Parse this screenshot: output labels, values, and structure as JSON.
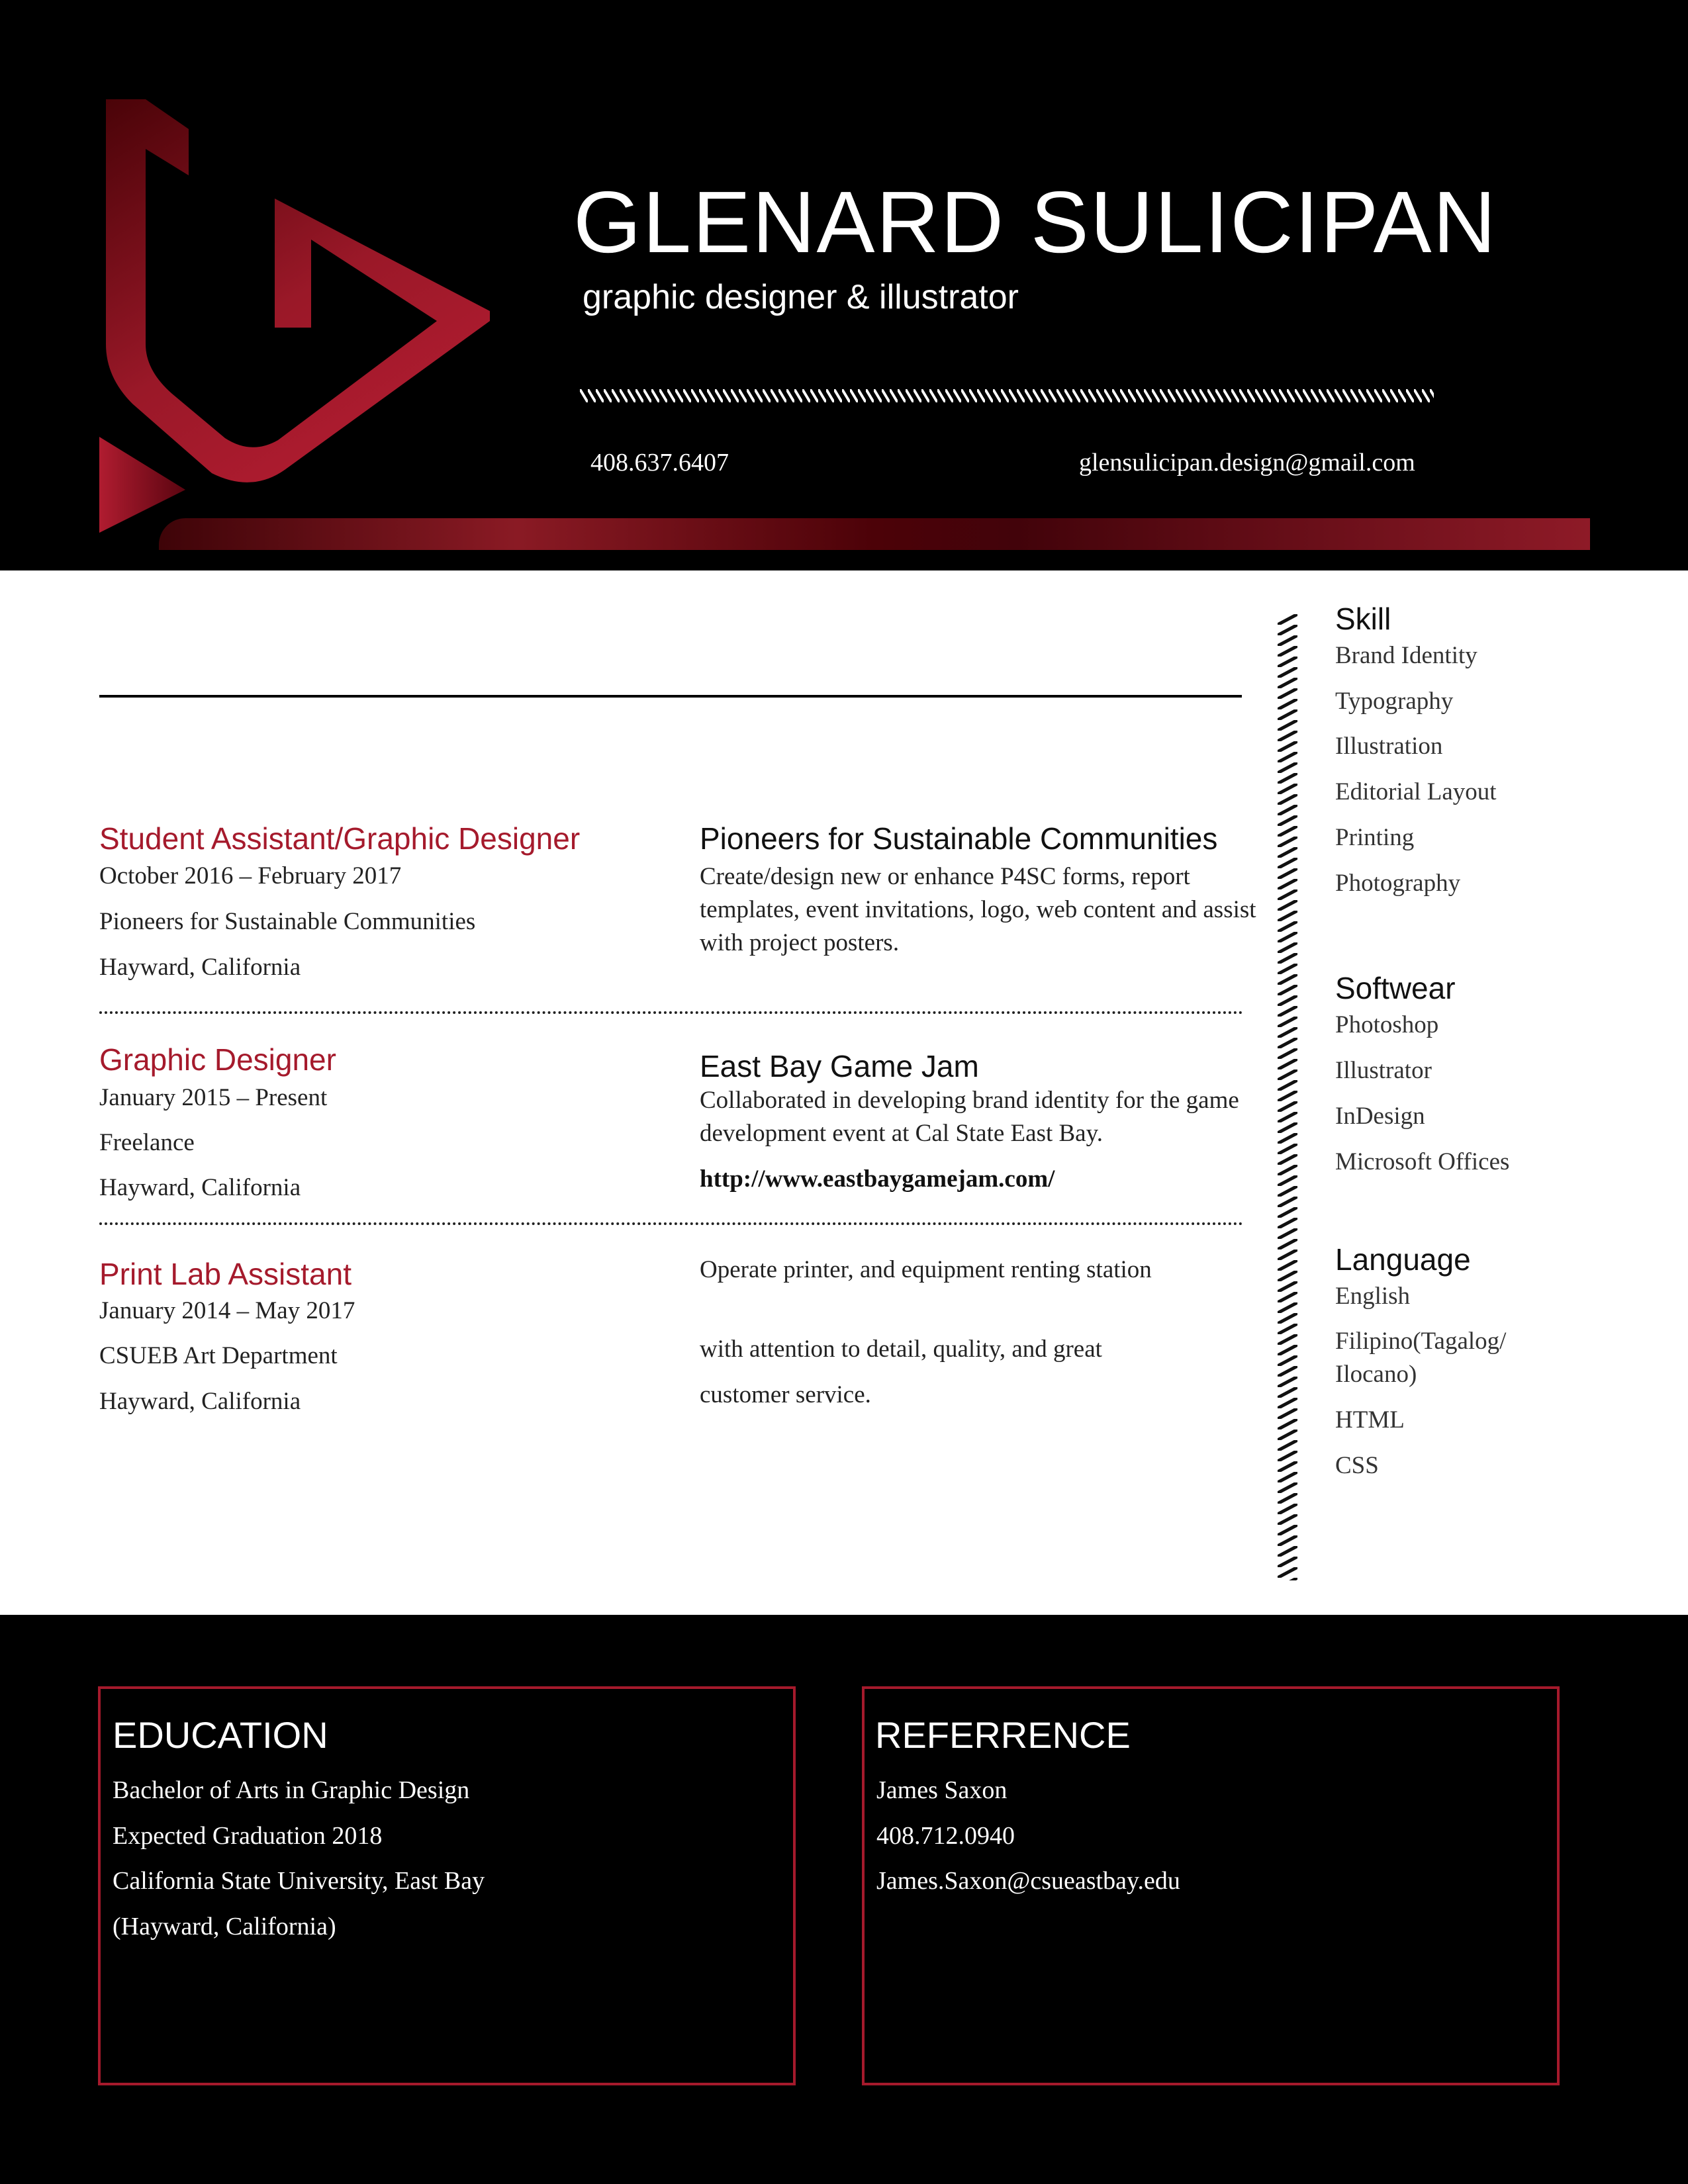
{
  "header": {
    "name": "GLENARD SULICIPAN",
    "subtitle": "graphic designer & illustrator",
    "phone": "408.637.6407",
    "email": "glensulicipan.design@gmail.com"
  },
  "experience": [
    {
      "title": "Student Assistant/Graphic Designer",
      "dates": "October 2016 – February 2017",
      "organization": "Pioneers for Sustainable Communities",
      "location": "Hayward, California",
      "detail_title": "Pioneers for Sustainable Communities",
      "description": "Create/design new or enhance P4SC forms, report templates, event invitations, logo, web content and assist with project posters."
    },
    {
      "title": "Graphic Designer",
      "dates": "January 2015 – Present",
      "organization": "Freelance",
      "location": "Hayward, California",
      "detail_title": "East Bay Game Jam",
      "description": "Collaborated in developing brand identity for the game development event at Cal State East Bay.",
      "link": "http://www.eastbaygamejam.com/"
    },
    {
      "title": "Print Lab Assistant",
      "dates": "January 2014 – May 2017",
      "organization": "CSUEB Art Department",
      "location": "Hayward, California",
      "description": "Operate printer, and equipment renting station",
      "description2": "with attention to detail, quality, and great",
      "description3": "customer service."
    }
  ],
  "sidebar": {
    "skill": {
      "heading": "Skill",
      "items": [
        "Brand Identity",
        "Typography",
        "Illustration",
        "Editorial Layout",
        "Printing",
        "Photography"
      ]
    },
    "software": {
      "heading": "Softwear",
      "items": [
        "Photoshop",
        "Illustrator",
        "InDesign",
        "Microsoft Offices"
      ]
    },
    "language": {
      "heading": "Language",
      "items": [
        "English",
        "Filipino(Tagalog/",
        "Ilocano)",
        "HTML",
        "CSS"
      ]
    }
  },
  "education": {
    "heading": "EDUCATION",
    "lines": [
      "Bachelor of Arts in Graphic Design",
      "Expected Graduation 2018",
      "California State University, East Bay",
      "(Hayward, California)"
    ]
  },
  "reference": {
    "heading": "REFERRENCE",
    "lines": [
      "James Saxon",
      "408.712.0940",
      "James.Saxon@csueastbay.edu"
    ]
  },
  "colors": {
    "accent": "#a51a2c",
    "background_dark": "#000000",
    "background_light": "#ffffff"
  }
}
